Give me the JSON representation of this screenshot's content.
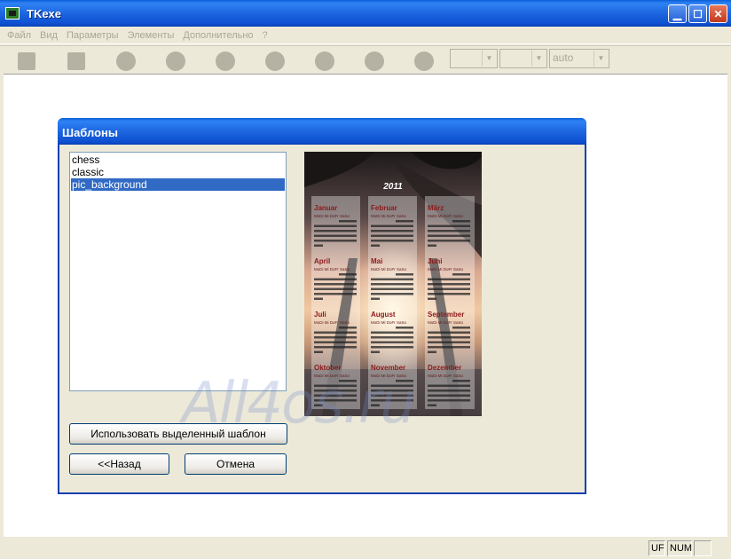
{
  "window": {
    "title": "TKexe"
  },
  "menu": [
    "Файл",
    "Вид",
    "Параметры",
    "Элементы",
    "Дополнительно",
    "?"
  ],
  "toolbar": {
    "combo3_value": "auto"
  },
  "dialog": {
    "title": "Шаблоны",
    "templates": [
      "chess",
      "classic",
      "pic_background"
    ],
    "selected_index": 2,
    "use_button": "Использовать выделенный шаблон",
    "back_button": "<<Назад",
    "cancel_button": "Отмена"
  },
  "preview": {
    "year": "2011",
    "months": [
      "Januar",
      "Februar",
      "März",
      "April",
      "Mai",
      "Juni",
      "Juli",
      "August",
      "September",
      "Oktober",
      "November",
      "Dezember"
    ],
    "weekday_header": "MoDi Mi DoFr SaSo"
  },
  "watermark": "All4os.ru",
  "status": {
    "uf": "UF",
    "num": "NUM"
  }
}
